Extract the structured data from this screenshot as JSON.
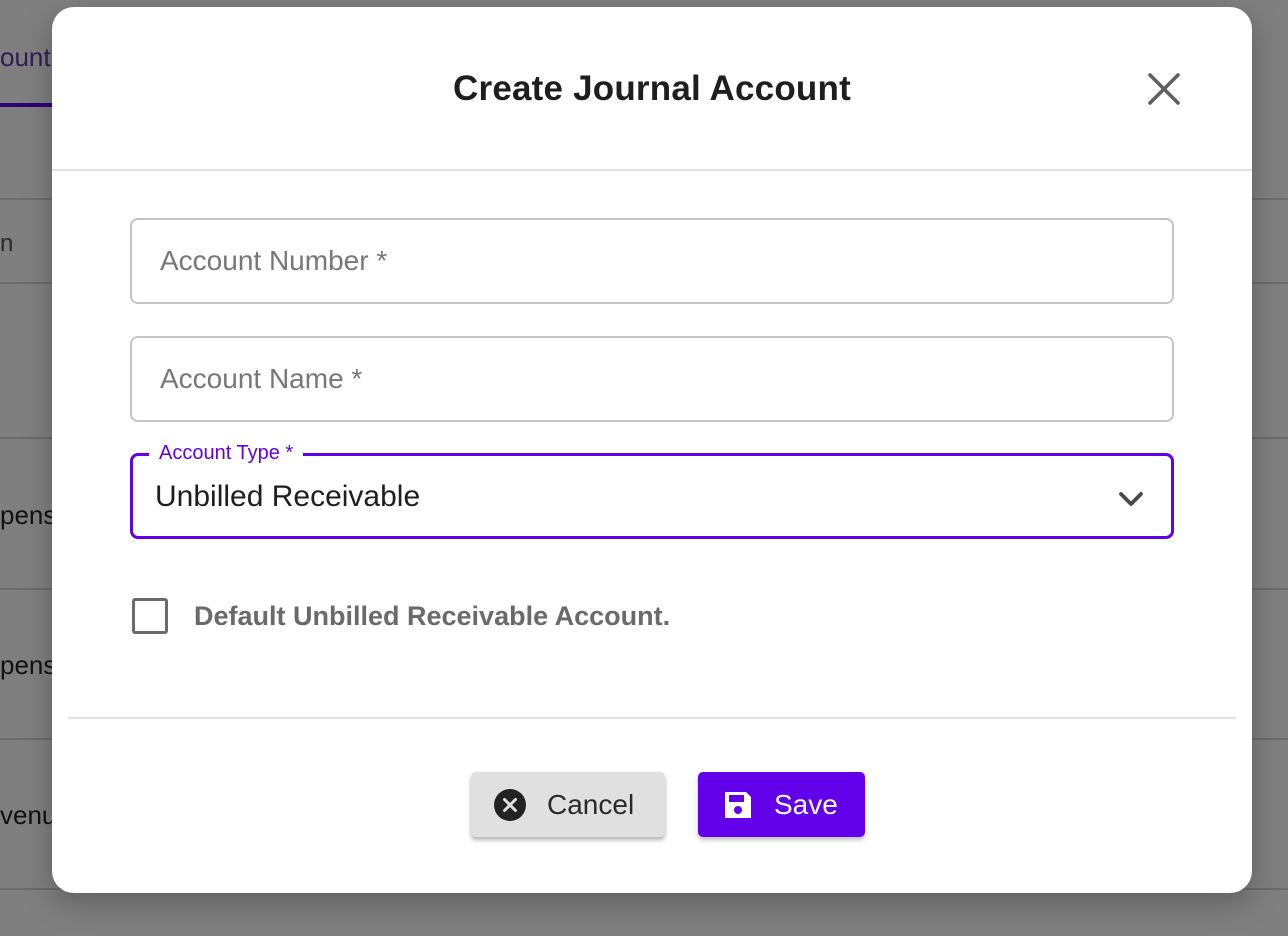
{
  "background": {
    "tab_label": "ount",
    "header_fragment": "n",
    "rows": [
      "pens",
      "pens",
      "venu"
    ]
  },
  "dialog": {
    "title": "Create Journal Account",
    "close_icon": "close-icon",
    "fields": {
      "account_number": {
        "placeholder": "Account Number *",
        "value": ""
      },
      "account_name": {
        "placeholder": "Account Name *",
        "value": ""
      }
    },
    "account_type": {
      "label": "Account Type *",
      "value": "Unbilled Receivable",
      "icon": "chevron-down-icon"
    },
    "default_checkbox": {
      "label": "Default Unbilled Receivable Account.",
      "checked": false
    },
    "buttons": {
      "cancel": {
        "label": "Cancel",
        "icon": "cancel-circle-icon"
      },
      "save": {
        "label": "Save",
        "icon": "floppy-disk-icon"
      }
    }
  },
  "colors": {
    "accent": "#6200ea",
    "overlay": "rgba(0,0,0,0.5)",
    "cancel_bg": "#e0e0e0"
  }
}
